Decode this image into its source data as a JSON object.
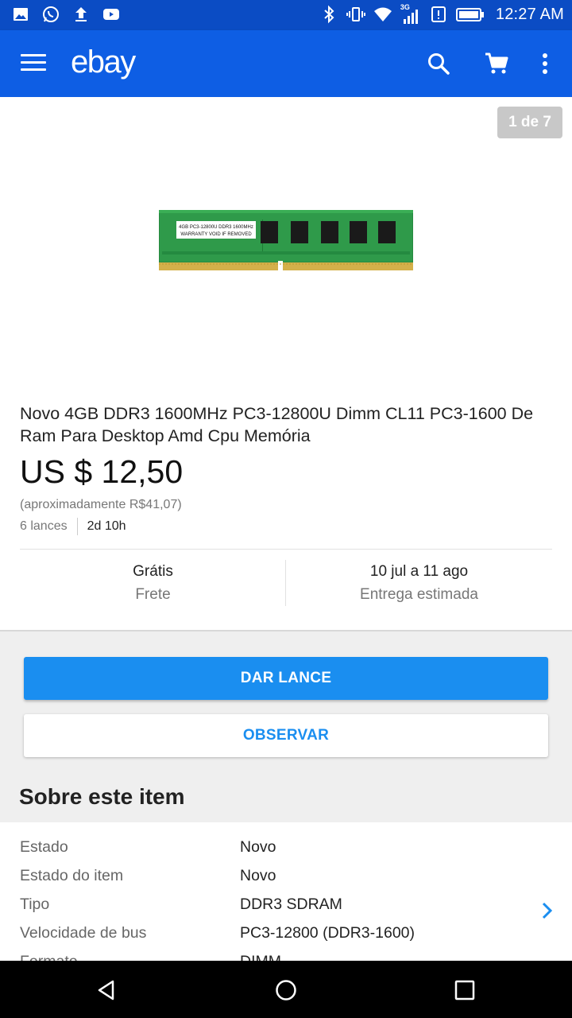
{
  "status_bar": {
    "time": "12:27 AM",
    "network_label": "3G",
    "icons_left": [
      "gallery-icon",
      "whatsapp-icon",
      "upload-icon",
      "youtube-icon"
    ],
    "icons_right": [
      "bluetooth-icon",
      "vibrate-icon",
      "wifi-icon",
      "cell-signal-icon",
      "alert-icon",
      "battery-icon"
    ]
  },
  "app_bar": {
    "logo": "ebay",
    "icons": [
      "menu-icon",
      "search-icon",
      "cart-icon",
      "more-vert-icon"
    ],
    "color": "#0e5ee4"
  },
  "gallery": {
    "counter": "1 de 7",
    "label_line1": "4GB PC3-12800U DDR3 1600MHz",
    "label_line2": "WARRANTY VOID IF REMOVED"
  },
  "listing": {
    "title": "Novo 4GB DDR3 1600MHz PC3-12800U Dimm CL11 PC3-1600 De Ram Para Desktop Amd Cpu Memória",
    "price": "US $ 12,50",
    "approx": "(aproximadamente R$41,07)",
    "bids": "6 lances",
    "time_left": "2d 10h"
  },
  "shipping": {
    "cost_value": "Grátis",
    "cost_label": "Frete",
    "delivery_value": "10 jul a 11 ago",
    "delivery_label": "Entrega estimada"
  },
  "actions": {
    "bid_label": "DAR LANCE",
    "watch_label": "OBSERVAR",
    "accent": "#1a8ef0"
  },
  "about": {
    "title": "Sobre este item",
    "rows": [
      {
        "key": "Estado",
        "value": "Novo"
      },
      {
        "key": "Estado do item",
        "value": "Novo"
      },
      {
        "key": "Tipo",
        "value": "DDR3 SDRAM"
      },
      {
        "key": "Velocidade de bus",
        "value": "PC3-12800 (DDR3-1600)"
      },
      {
        "key": "Formato",
        "value": "DIMM"
      }
    ]
  },
  "nav_bar": {
    "icons": [
      "back-icon",
      "home-icon",
      "recents-icon"
    ]
  }
}
